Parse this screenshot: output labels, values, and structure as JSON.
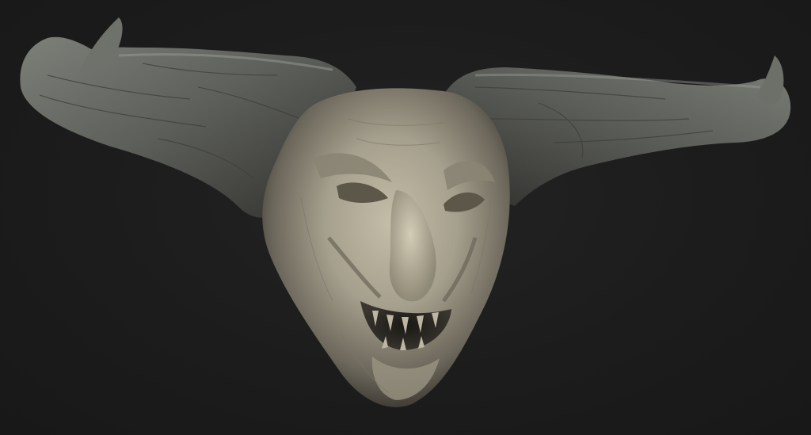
{
  "scene": {
    "subject": "demon-head-sculpt",
    "background_color": "#1c1c1c",
    "colors": {
      "horn": "#5e605b",
      "horn_highlight": "#8d8f88",
      "horn_shadow": "#2e2f2c",
      "skin": "#a59f8d",
      "skin_highlight": "#c9c2ad",
      "skin_shadow": "#4a463d"
    }
  }
}
